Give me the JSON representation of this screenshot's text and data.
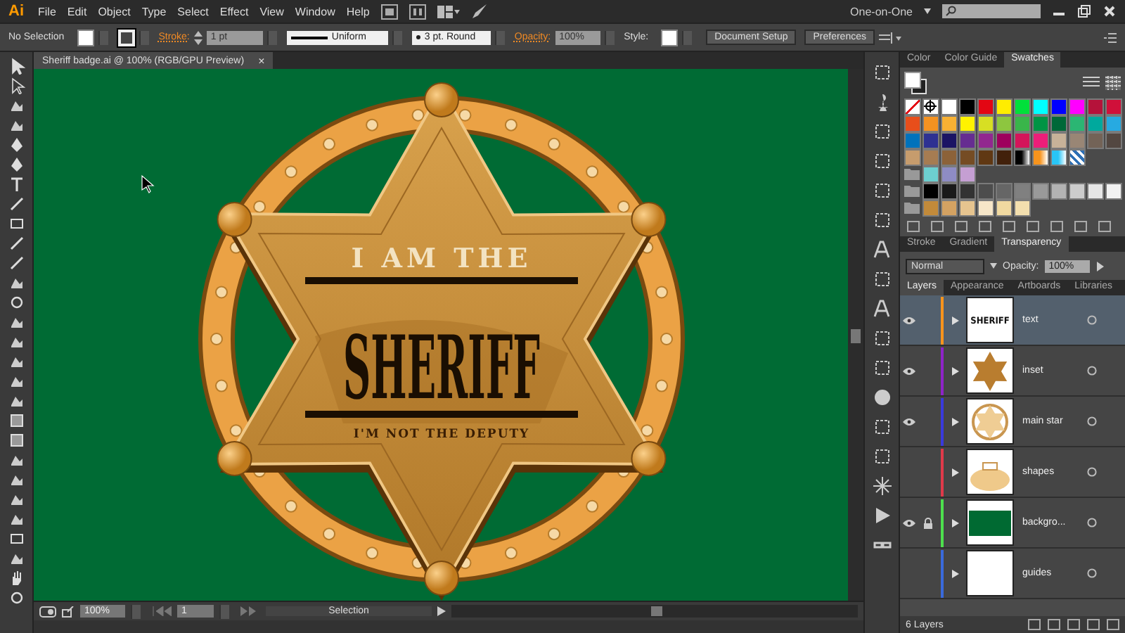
{
  "menu_bar": {
    "logo": "Ai",
    "items": [
      "File",
      "Edit",
      "Object",
      "Type",
      "Select",
      "Effect",
      "View",
      "Window",
      "Help"
    ],
    "workspace": "One-on-One"
  },
  "control_bar": {
    "selection": "No Selection",
    "stroke_label": "Stroke:",
    "stroke_weight": "1 pt",
    "profile": "Uniform",
    "brush": "3 pt. Round",
    "opacity_label": "Opacity:",
    "opacity": "100%",
    "style_label": "Style:",
    "buttons": [
      "Document Setup",
      "Preferences"
    ]
  },
  "document_tab": {
    "title": "Sheriff badge.ai @ 100% (RGB/GPU Preview)",
    "close": "×"
  },
  "artwork": {
    "top_text": "I AM THE",
    "main_text": "SHERIFF",
    "bottom_text": "I'M NOT THE DEPUTY"
  },
  "color_panel": {
    "tabs": [
      {
        "label": "Color",
        "selected": false
      },
      {
        "label": "Color Guide",
        "selected": false
      },
      {
        "label": "Swatches",
        "selected": true
      }
    ],
    "swatch_rows": [
      [
        {
          "kind": "none",
          "color": "#ffffff"
        },
        {
          "kind": "registration",
          "color": "#ffffff"
        },
        {
          "kind": "solid",
          "color": "#ffffff"
        },
        {
          "kind": "solid",
          "color": "#000000"
        },
        {
          "kind": "solid",
          "color": "#e30613"
        },
        {
          "kind": "solid",
          "color": "#ffed00"
        },
        {
          "kind": "solid",
          "color": "#00e03a"
        },
        {
          "kind": "solid",
          "color": "#00ffff"
        },
        {
          "kind": "solid",
          "color": "#0000ff"
        },
        {
          "kind": "solid",
          "color": "#ff00ff"
        },
        {
          "kind": "solid",
          "color": "#b5123a"
        },
        {
          "kind": "solid",
          "color": "#d0103a"
        }
      ],
      [
        {
          "kind": "solid",
          "color": "#e84e1b"
        },
        {
          "kind": "solid",
          "color": "#f39221"
        },
        {
          "kind": "solid",
          "color": "#f8b133"
        },
        {
          "kind": "solid",
          "color": "#fff200"
        },
        {
          "kind": "solid",
          "color": "#d7df23"
        },
        {
          "kind": "solid",
          "color": "#8dc63f"
        },
        {
          "kind": "solid",
          "color": "#39b54a"
        },
        {
          "kind": "solid",
          "color": "#009444"
        },
        {
          "kind": "solid",
          "color": "#006838"
        },
        {
          "kind": "solid",
          "color": "#2bb673"
        },
        {
          "kind": "solid",
          "color": "#00a99d"
        },
        {
          "kind": "solid",
          "color": "#27aae1"
        }
      ],
      [
        {
          "kind": "solid",
          "color": "#0072bc"
        },
        {
          "kind": "solid",
          "color": "#2e3192"
        },
        {
          "kind": "solid",
          "color": "#1b1464"
        },
        {
          "kind": "solid",
          "color": "#662d91"
        },
        {
          "kind": "solid",
          "color": "#92278f"
        },
        {
          "kind": "solid",
          "color": "#9e005d"
        },
        {
          "kind": "solid",
          "color": "#d4145a"
        },
        {
          "kind": "solid",
          "color": "#ed1e79"
        },
        {
          "kind": "solid",
          "color": "#c7b299"
        },
        {
          "kind": "solid",
          "color": "#998675"
        },
        {
          "kind": "solid",
          "color": "#736357"
        },
        {
          "kind": "solid",
          "color": "#534741"
        }
      ],
      [
        {
          "kind": "solid",
          "color": "#c69c6d"
        },
        {
          "kind": "solid",
          "color": "#a67c52"
        },
        {
          "kind": "solid",
          "color": "#8c6239"
        },
        {
          "kind": "solid",
          "color": "#754c24"
        },
        {
          "kind": "solid",
          "color": "#603813"
        },
        {
          "kind": "solid",
          "color": "#42210b"
        },
        {
          "kind": "gradient",
          "color": "#000000"
        },
        {
          "kind": "gradient",
          "color": "#f7941d"
        },
        {
          "kind": "gradient",
          "color": "#29c5f6"
        },
        {
          "kind": "pattern",
          "color": "#2d6fb5"
        }
      ]
    ],
    "swatch_groups": [
      [
        {
          "kind": "solid",
          "color": "#6dcfd0"
        },
        {
          "kind": "solid",
          "color": "#8e8cc4"
        },
        {
          "kind": "solid",
          "color": "#c59fd3"
        }
      ],
      [
        {
          "kind": "solid",
          "color": "#000000"
        },
        {
          "kind": "solid",
          "color": "#1a1a1a"
        },
        {
          "kind": "solid",
          "color": "#333333"
        },
        {
          "kind": "solid",
          "color": "#4d4d4d"
        },
        {
          "kind": "solid",
          "color": "#666666"
        },
        {
          "kind": "solid",
          "color": "#808080"
        },
        {
          "kind": "solid",
          "color": "#999999"
        },
        {
          "kind": "solid",
          "color": "#b3b3b3"
        },
        {
          "kind": "solid",
          "color": "#cccccc"
        },
        {
          "kind": "solid",
          "color": "#e6e6e6"
        },
        {
          "kind": "solid",
          "color": "#f2f2f2"
        }
      ],
      [
        {
          "kind": "solid",
          "color": "#c28a3a"
        },
        {
          "kind": "solid",
          "color": "#d4a262"
        },
        {
          "kind": "solid",
          "color": "#e6c48f"
        },
        {
          "kind": "solid",
          "color": "#f6e6c8"
        },
        {
          "kind": "solid",
          "color": "#f0d9a0"
        },
        {
          "kind": "solid",
          "color": "#f3dfae"
        }
      ]
    ]
  },
  "transparency_panel": {
    "tabs": [
      {
        "label": "Stroke",
        "selected": false
      },
      {
        "label": "Gradient",
        "selected": false
      },
      {
        "label": "Transparency",
        "selected": true
      }
    ],
    "blend_mode": "Normal",
    "opacity_label": "Opacity:",
    "opacity": "100%"
  },
  "layers_panel": {
    "tabs": [
      {
        "label": "Layers",
        "selected": true
      },
      {
        "label": "Appearance",
        "selected": false
      },
      {
        "label": "Artboards",
        "selected": false
      },
      {
        "label": "Libraries",
        "selected": false
      }
    ],
    "layers": [
      {
        "name": "text",
        "visible": true,
        "locked": false,
        "selected": true,
        "color": "#f7941d",
        "kind": "text",
        "thumbnail_text": "SHERIFF"
      },
      {
        "name": "inset",
        "visible": true,
        "locked": false,
        "selected": false,
        "color": "#8e24c8",
        "kind": "star"
      },
      {
        "name": "main star",
        "visible": true,
        "locked": false,
        "selected": false,
        "color": "#3a3adc",
        "kind": "ring"
      },
      {
        "name": "shapes",
        "visible": false,
        "locked": false,
        "selected": false,
        "color": "#e03a4a",
        "kind": "shapes"
      },
      {
        "name": "backgro...",
        "visible": true,
        "locked": true,
        "selected": false,
        "color": "#4ee04e",
        "kind": "background"
      },
      {
        "name": "guides",
        "visible": false,
        "locked": false,
        "selected": false,
        "color": "#3a6adc",
        "kind": "blank"
      }
    ],
    "count": "6 Layers"
  },
  "status_bar": {
    "zoom": "100%",
    "artboard": "1",
    "tool": "Selection"
  }
}
